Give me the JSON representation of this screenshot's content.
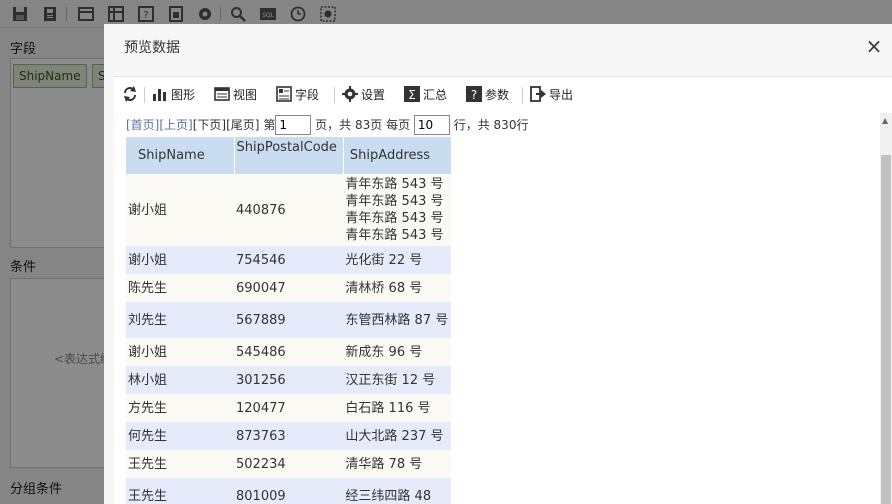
{
  "background": {
    "sections": {
      "fields": "字段",
      "conditions": "条件",
      "group_conditions": "分组条件"
    },
    "field_tags": [
      "ShipName",
      "S"
    ],
    "condition_hint": "<表达式编"
  },
  "dialog": {
    "title": "预览数据",
    "close": "×",
    "toolbar": {
      "chart": "图形",
      "view": "视图",
      "fields": "字段",
      "settings": "设置",
      "summary": "汇总",
      "params": "参数",
      "export": "导出"
    },
    "pager": {
      "first": "[首页]",
      "prev": "[上页]",
      "next": "[下页]",
      "last": "[尾页]",
      "page_prefix": "第",
      "current_page": "1",
      "page_suffix": "页，共 83页 每页",
      "page_size": "10",
      "total_suffix": "行，共 830行"
    },
    "table": {
      "columns": [
        "ShipName",
        "ShipPostalCode",
        "ShipAddress"
      ],
      "rows": [
        {
          "name": "谢小姐",
          "postal": "440876",
          "address": "青年东路 543 号 青年东路 543 号 青年东路 543 号 青年东路 543 号"
        },
        {
          "name": "谢小姐",
          "postal": "754546",
          "address": "光化街 22 号"
        },
        {
          "name": "陈先生",
          "postal": "690047",
          "address": "清林桥 68 号"
        },
        {
          "name": "刘先生",
          "postal": "567889",
          "address": "东管西林路 87 号"
        },
        {
          "name": "谢小姐",
          "postal": "545486",
          "address": "新成东 96 号"
        },
        {
          "name": "林小姐",
          "postal": "301256",
          "address": "汉正东街 12 号"
        },
        {
          "name": "方先生",
          "postal": "120477",
          "address": "白石路 116 号"
        },
        {
          "name": "何先生",
          "postal": "873763",
          "address": "山大北路 237 号"
        },
        {
          "name": "王先生",
          "postal": "502234",
          "address": "清华路 78 号"
        },
        {
          "name": "王先生",
          "postal": "801009",
          "address": "经三纬四路 48"
        }
      ]
    }
  }
}
